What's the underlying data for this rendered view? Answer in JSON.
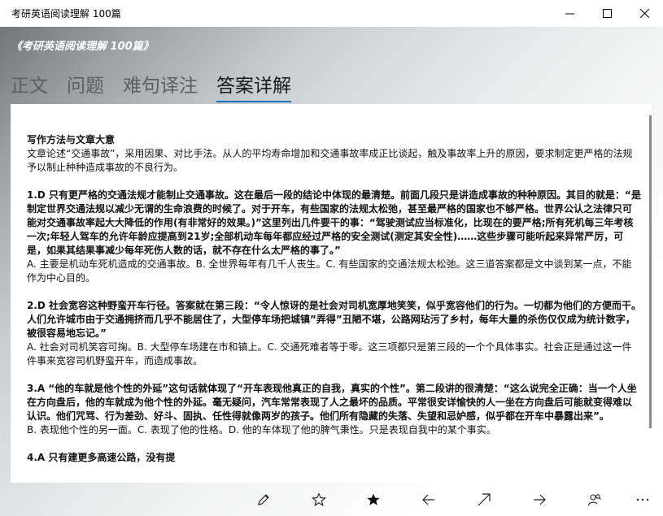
{
  "window": {
    "title": "考研英语阅读理解 100篇"
  },
  "app": {
    "header": "《考研英语阅读理解 100篇》"
  },
  "tabs": [
    {
      "label": "正文",
      "active": false
    },
    {
      "label": "问题",
      "active": false
    },
    {
      "label": "难句译注",
      "active": false
    },
    {
      "label": "答案详解",
      "active": true
    }
  ],
  "article": {
    "heading": "写作方法与文章大意",
    "intro": "文章论述“交通事故”，采用因果、对比手法。从人的平均寿命增加和交通事故率成正比谈起，触及事故率上升的原因，要求制定更严格的法规予以制止种种造成事故的不良行为。",
    "answers": [
      {
        "bold": "1.D 只有更严格的交通法规才能制止交通事故。这在最后一段的结论中体现的最清楚。前面几段只是讲造成事故的种种原因。其目的就是：“是制定世界交通法规以减少无谓的生命浪费的时候了。对于开车，有些国家的法规太松弛，甚至最严格的国家也不够严格。世界公认之法律只可能对交通事故率起大大降低的作用(有非常好的效果。)”这里列出几件要干的事：“驾驶测试应当标准化，比现在的要严格;所有死机每三年考核一次;年轻人驾车的允许年龄应提高到21岁;全部机动车每年都应经过严格的安全测试(测定其安全性)……这些步骤可能听起来异常严厉，可是，如果其结果事减少每年死伤人数的话，就不存在什么太严格的事了。”",
        "normal": "A. 主要是机动车死机造成的交通事故。B. 全世界每年有几千人丧生。C. 有些国家的交通法规太松弛。这三道答案都是文中谈到某一点，不能作为中心目的。"
      },
      {
        "bold": "2.D 社会宽容这种野蛮开车行径。答案就在第三段：“令人惊讶的是社会对司机宽厚地笑笑，似乎宽容他们的行为。一切都为他们的方便而干。人们允许城市由于交通拥挤而几乎不能居住了，大型停车场把城镇”弄得”丑陋不堪，公路网玷污了乡村，每年大量的杀伤仅仅成为统计数字，被很容易地忘记。”",
        "normal": "A. 社会对司机笑容可掬。B. 大型停车场建在市和镇上。C. 交通死难者等于零。这三项都只是第三段的一个个具体事实。社会正是通过这一件件事来宽容司机野蛮开车，而造成事故。"
      },
      {
        "bold": "3.A “他的车就是他个性的外延”这句话就体现了“开车表现他真正的自我，真实的个性”。第二段讲的很清楚：“这么说完全正确：当一个人坐在方向盘后，他的车就成为他个性的外延。毫无疑问，汽车常常表现了人之最坏的品质。平常很安详愉快的人一坐在方向盘后可能就变得难以认识。他们咒骂、行为差劲、好斗、固执、任性得就像两岁的孩子。他们所有隐藏的失落、失望和忌妒感，似乎都在开车中暴露出来”。",
        "normal": "B. 表现他个性的另一面。C. 表现了他的性格。D. 他的车体现了他的脾气秉性。只是表现自我中的某个事实。"
      },
      {
        "bold": "4.A 只有建更多高速公路，没有提",
        "normal": ""
      }
    ]
  },
  "appbar": {
    "icons": [
      "pencil-icon",
      "star-outline-icon",
      "star-filled-icon",
      "arrow-left-icon",
      "arrow-up-right-icon",
      "arrow-right-icon",
      "person-search-icon",
      "more-icon"
    ]
  }
}
